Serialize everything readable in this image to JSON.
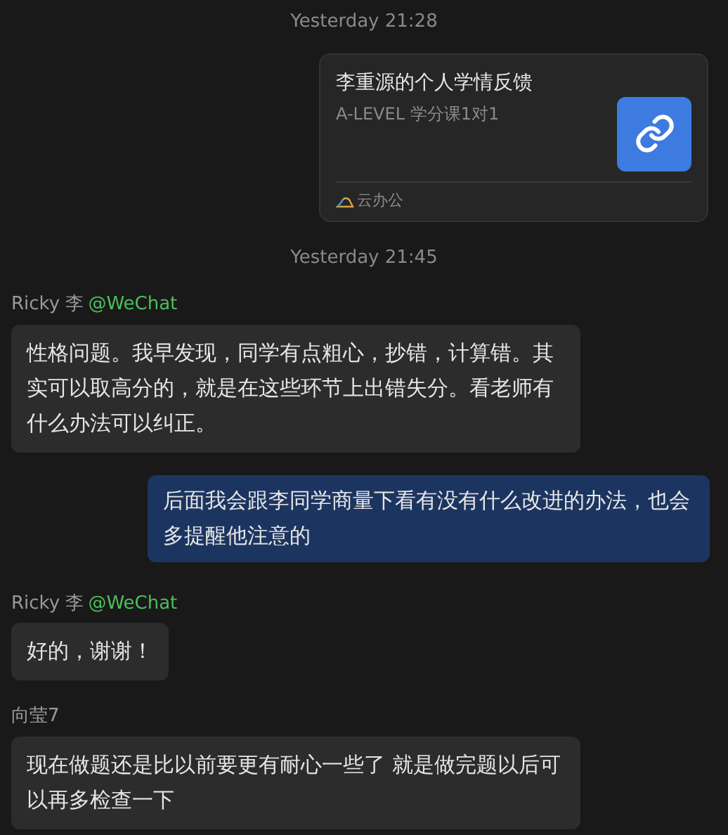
{
  "messages": [
    {
      "kind": "timestamp",
      "text": "Yesterday 21:28"
    },
    {
      "kind": "link_card",
      "title": "李重源的个人学情反馈",
      "subtitle": "A-LEVEL 学分课1对1",
      "source": "云办公"
    },
    {
      "kind": "timestamp",
      "text": "Yesterday 21:45"
    },
    {
      "kind": "incoming",
      "sender": "Ricky 李",
      "sender_tag": "@WeChat",
      "text": "性格问题。我早发现，同学有点粗心，抄错，计算错。其实可以取高分的，就是在这些环节上出错失分。看老师有什么办法可以纠正。"
    },
    {
      "kind": "outgoing",
      "text": "后面我会跟李同学商量下看有没有什么改进的办法，也会多提醒他注意的"
    },
    {
      "kind": "incoming",
      "sender": "Ricky 李",
      "sender_tag": "@WeChat",
      "text": "好的，谢谢！"
    },
    {
      "kind": "incoming",
      "sender": "向莹7",
      "text": "现在做题还是比以前要更有耐心一些了 就是做完题以后可以再多检查一下"
    }
  ]
}
